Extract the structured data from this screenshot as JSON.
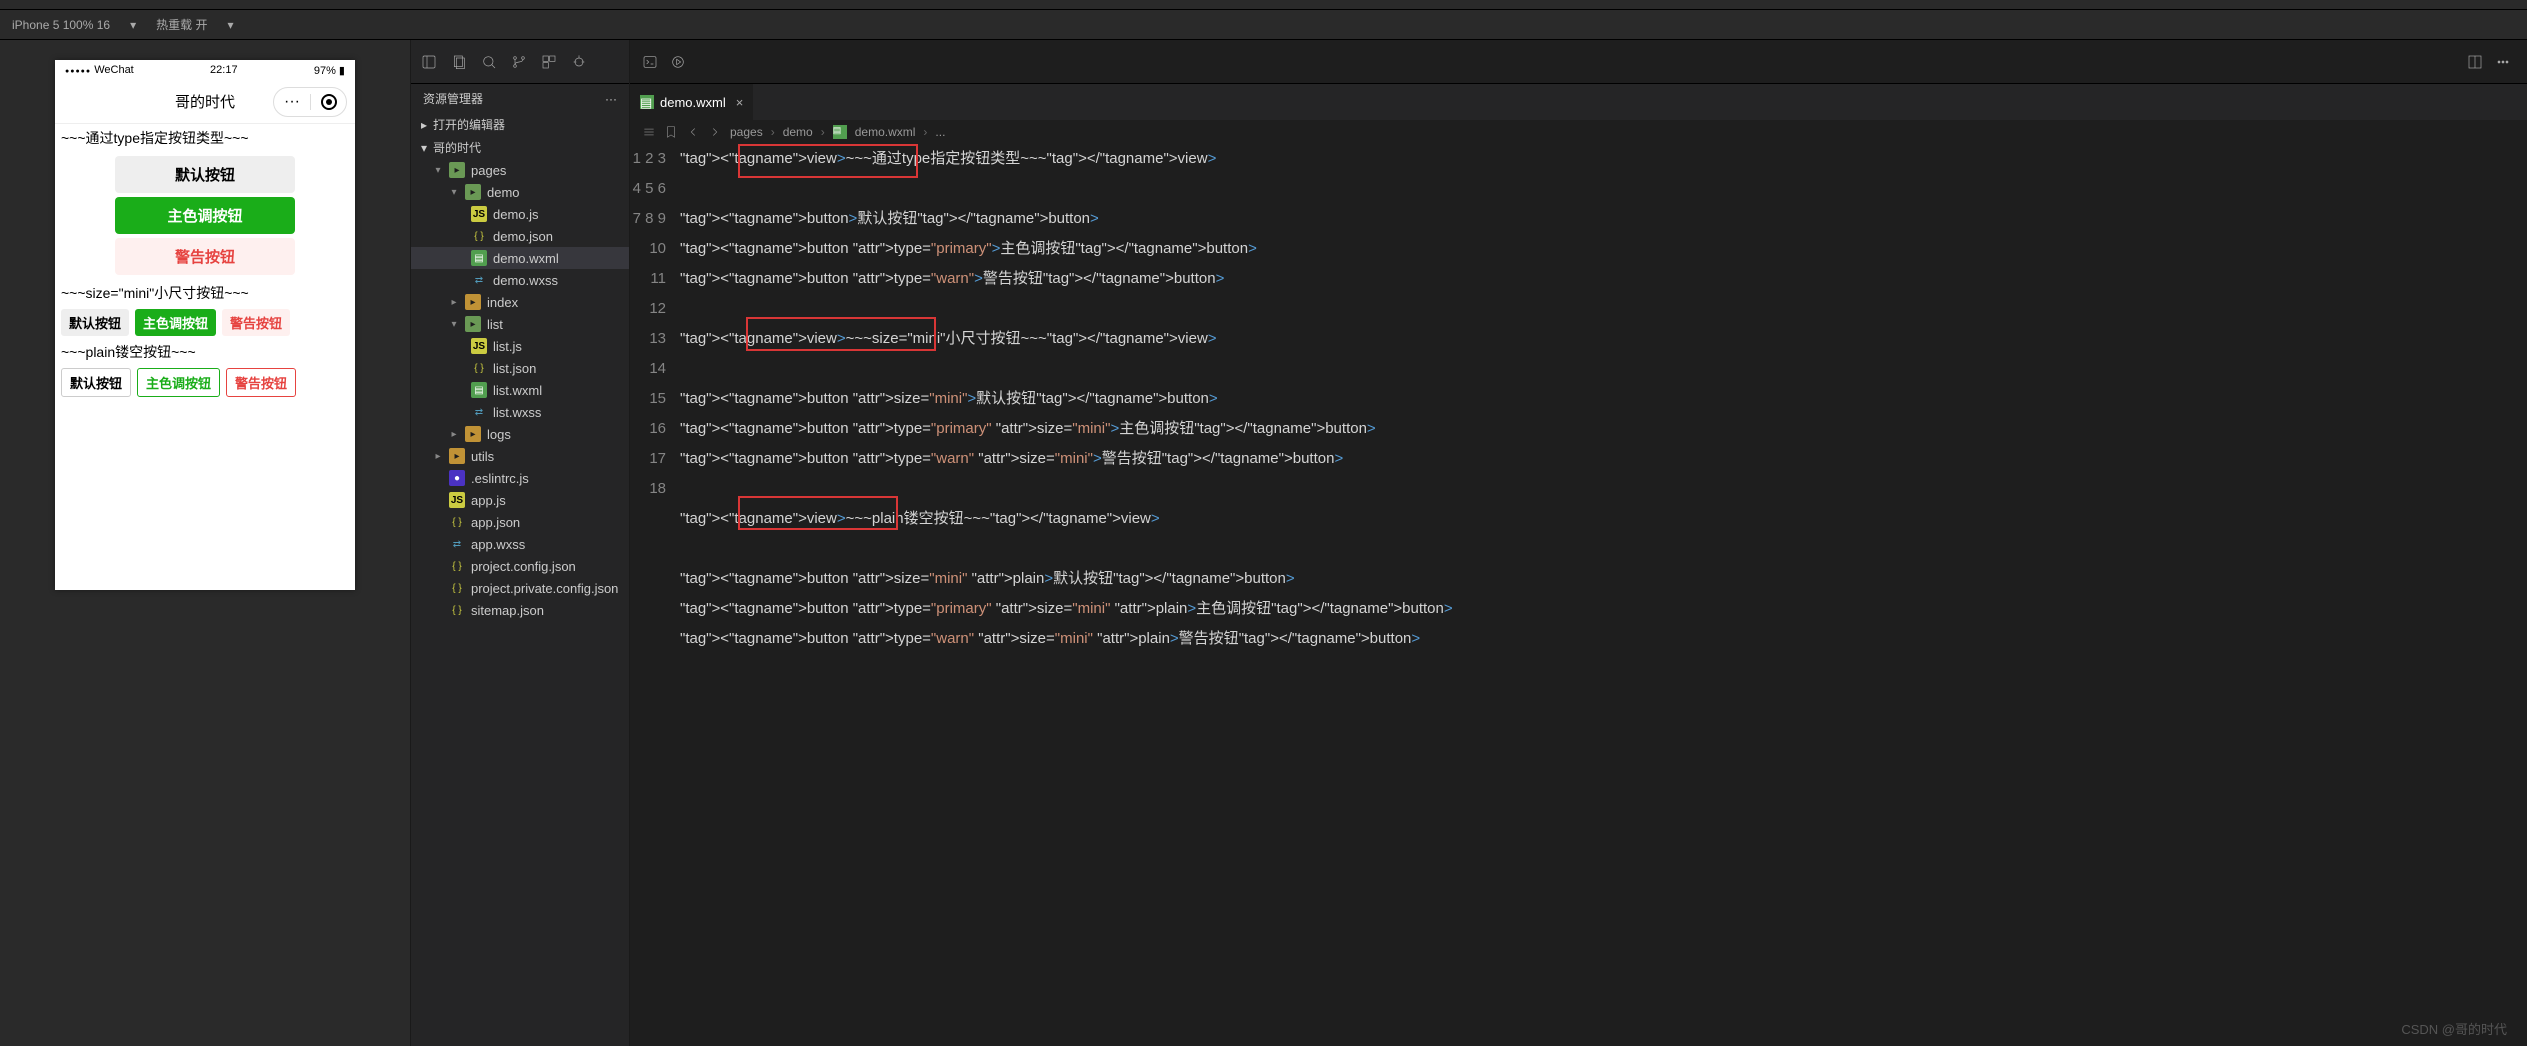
{
  "toolbar": {
    "device": "iPhone 5 100% 16",
    "hot_reload": "热重载 开"
  },
  "simulator": {
    "carrier": "WeChat",
    "time": "22:17",
    "battery": "97%",
    "page_title": "哥的时代",
    "section1": "~~~通过type指定按钮类型~~~",
    "btn_default": "默认按钮",
    "btn_primary": "主色调按钮",
    "btn_warn": "警告按钮",
    "section2": "~~~size=\"mini\"小尺寸按钮~~~",
    "mini_default": "默认按钮",
    "mini_primary": "主色调按钮",
    "mini_warn": "警告按钮",
    "section3": "~~~plain镂空按钮~~~",
    "plain_default": "默认按钮",
    "plain_primary": "主色调按钮",
    "plain_warn": "警告按钮"
  },
  "explorer": {
    "title": "资源管理器",
    "open_editors": "打开的编辑器",
    "root": "哥的时代",
    "pages": "pages",
    "demo": "demo",
    "demo_js": "demo.js",
    "demo_json": "demo.json",
    "demo_wxml": "demo.wxml",
    "demo_wxss": "demo.wxss",
    "index": "index",
    "list": "list",
    "list_js": "list.js",
    "list_json": "list.json",
    "list_wxml": "list.wxml",
    "list_wxss": "list.wxss",
    "logs": "logs",
    "utils": "utils",
    "eslintrc": ".eslintrc.js",
    "app_js": "app.js",
    "app_json": "app.json",
    "app_wxss": "app.wxss",
    "proj_config": "project.config.json",
    "proj_private": "project.private.config.json",
    "sitemap": "sitemap.json"
  },
  "editor": {
    "tab_name": "demo.wxml",
    "breadcrumb": {
      "a": "pages",
      "b": "demo",
      "c": "demo.wxml",
      "d": "..."
    },
    "lines": {
      "l1": {
        "pre": "<view>",
        "txt": "~~~通过type指定按钮类型~~~",
        "post": "</view>"
      },
      "l3": {
        "pre": "<button>",
        "txt": "默认按钮",
        "post": "</button>"
      },
      "l4": {
        "pre": "<button type=\"primary\">",
        "txt": "主色调按钮",
        "post": "</button>"
      },
      "l5": {
        "pre": "<button type=\"warn\">",
        "txt": "警告按钮",
        "post": "</button>"
      },
      "l7": {
        "pre": "<view>",
        "txt": "~~~size=\"mini\"小尺寸按钮~~~",
        "post": "</view>"
      },
      "l9": {
        "pre": "<button size=\"mini\">",
        "txt": "默认按钮",
        "post": "</button>"
      },
      "l10": {
        "pre": "<button type=\"primary\" size=\"mini\">",
        "txt": "主色调按钮",
        "post": "</button>"
      },
      "l11": {
        "pre": "<button type=\"warn\" size=\"mini\">",
        "txt": "警告按钮",
        "post": "</button>"
      },
      "l13": {
        "pre": "<view>",
        "txt": "~~~plain镂空按钮~~~",
        "post": "</view>"
      },
      "l15": {
        "pre": "<button size=\"mini\" plain>",
        "txt": "默认按钮",
        "post": "</button>"
      },
      "l16": {
        "pre": "<button type=\"primary\" size=\"mini\" plain>",
        "txt": "主色调按钮",
        "post": "</button>"
      },
      "l17": {
        "pre": "<button type=\"warn\" size=\"mini\" plain>",
        "txt": "警告按钮",
        "post": "</button>"
      }
    }
  },
  "watermark": "CSDN @哥的时代"
}
